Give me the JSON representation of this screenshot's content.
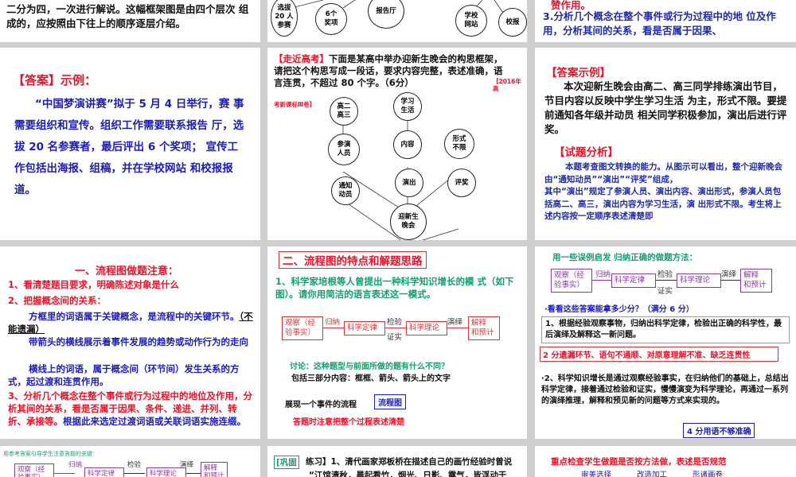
{
  "slide1": {
    "text": "二分为四，一次进行解说。这幅框架图是由四个层次 组成的，应按照由下往上的顺序逐层介绍。"
  },
  "slide2": {
    "n1": "选拔\n20 人\n参赛",
    "n2": "6个\n奖项",
    "n3": "报告厅",
    "n4": "学校\n网站",
    "n5": "校报"
  },
  "slide3": {
    "line1": "赞作用。",
    "line2": "3.分析几个概念在整个事件或行为过程中的地 位及作用，分析其间的关系，看是否属于因果、"
  },
  "slide4": {
    "heading": "【答案】示例：",
    "body": "“中国梦演讲赛”拟于 5 月 4 日举行，赛 事需要组织和宣传。组织工作需要联系报告 厅，选拔 20 名参赛者，最后评出 6 个奖项； 宣传工作包括出海报、组稿，并在学校网站 和校报报道。"
  },
  "slide5": {
    "tag": "【走近高考】",
    "question": "下面是某高中举办迎新生晚会的构思框架，请把这个构思写成一段话，要求内容完整，表述准确，语言连贯，不超过 80 个字。（6分）",
    "source": "【2016年高",
    "source2": "考新课标Ⅲ卷】",
    "nodes": {
      "grade": "高二\n高三",
      "study": "学习\n生活",
      "people": "参演\n人员",
      "content": "内容",
      "form": "形式\n不限",
      "notify": "通知\n动员",
      "perform": "演出",
      "judge": "评奖",
      "party": "迎新生\n晚会"
    }
  },
  "slide6": {
    "heading": "【答案示例】",
    "body": "本次迎新生晚会由高二、高三同学排练演出节目，节目内容以反映中学生学习生活 为主，形式不限。要提前通知各年级并动员 相关同学积极参加，演出后进行评奖。",
    "analysis_heading": "【试题分析】",
    "analysis": "本题考查图文转换的能力。从图示可以看出，整个迎新晚会由“通知动员”“演出”“评奖”组成，\n其中“演出”规定了参演人员、演出内容、演出形式，参演人员包括高二、高三，演出内容为学习生活，演 出形式不限。考生将上述内容按一定顺序表述清楚即"
  },
  "slide7": {
    "title": "一、流程图做题注意：",
    "p1": "1、看清楚题目要求，明确陈述对象是什么",
    "p2": "2、把握概念间的关系：",
    "p3a": "方框里的词语属于关键概念，是流程中的关键环节。",
    "p3b": "（不能遗漏）",
    "p4": "带箭头的横线展示着事件发展的趋势或动作行为的走向",
    "p5": "横线上的词语，属于概念间（环节间）发生关系的方式，起过渡和连贯作用。",
    "p6": "3、分析几个概念在整个事件或行为过程中的地位及作用，分析其间的关系，看是否属于因果、条件、递进、并列、转折、承接等。",
    "p6b": "根据此来选定过渡词语或关联词语实施连缀。"
  },
  "slide8": {
    "title": "二、流程图的特点和解题思路",
    "q": "1、科学家培根等人曾提出一种科学知识增长的模 式（如下图）。请你用简洁的语言表述这一模式。",
    "flow": {
      "b1": "观察（经\n验事实）",
      "a1": "归纳",
      "b2": "科学定律",
      "a2": "检验",
      "a2b": "证实",
      "b3": "科学理论",
      "a3": "演绎",
      "b4": "解释\n和预计"
    },
    "discuss": "讨论：这种题型与前面所做的题有什么不同？",
    "three": "包括三部分内容：框框、箭头、箭头上的文字",
    "show": "展现一个事件的流程",
    "flowchart_label": "流程图",
    "note": "答题时注意把整个过程表述清楚"
  },
  "slide9": {
    "title": "用一些误例启发 归纳正确的做题方法：",
    "flow": {
      "b1": "观察（经\n验事实）",
      "a1": "归纳",
      "b2": "科学定律",
      "a2": "检验",
      "a2b": "证实",
      "b3": "科学理论",
      "a3": "演绎",
      "b4": "解释\n和预计"
    },
    "score_q": "·看看这些答案能拿多少分？（满分 6 分）",
    "ans1": "1、根据经验观察事物，归纳出科学定律，检验出正确的科学性，最后演绎及解释这一新问题。",
    "comment1": "2 分遗漏环节、语句不通顺、对原意理解不准、缺乏连贯性",
    "ans2": "·2、科学知识增长是通过观察经验事实，在归纳他们的基础上，总结出科学定律，接着通过检验和证实，慢慢演变为科学理论，再通过一系列的演绎推理，解释和预见新的问题等方式来实现的。",
    "comment2": "4 分用语不够准确"
  },
  "slide10": {
    "title": "用参考答案引导学生注意答题的关键：",
    "flow": {
      "b1": "观察（经\n验事实）",
      "a1": "归纳",
      "b2": "科学定律",
      "a2": "检验",
      "b3": "科学理论",
      "a3": "演绎",
      "b4": "解释\n和预计"
    }
  },
  "slide11": {
    "tag": "[巩固",
    "line": "练习】1、清代画家郑板桥在描述自己的画竹经验时曾说",
    "line2": "“江馆清秋，晨起看竹，烟光、日影、露气，皆浮动于"
  },
  "slide12": {
    "text": "重点检查学生做题是否按方法做，表述是否规范",
    "w1": "审美选择",
    "w2": "改造加工",
    "w3": "形诸画卷"
  }
}
